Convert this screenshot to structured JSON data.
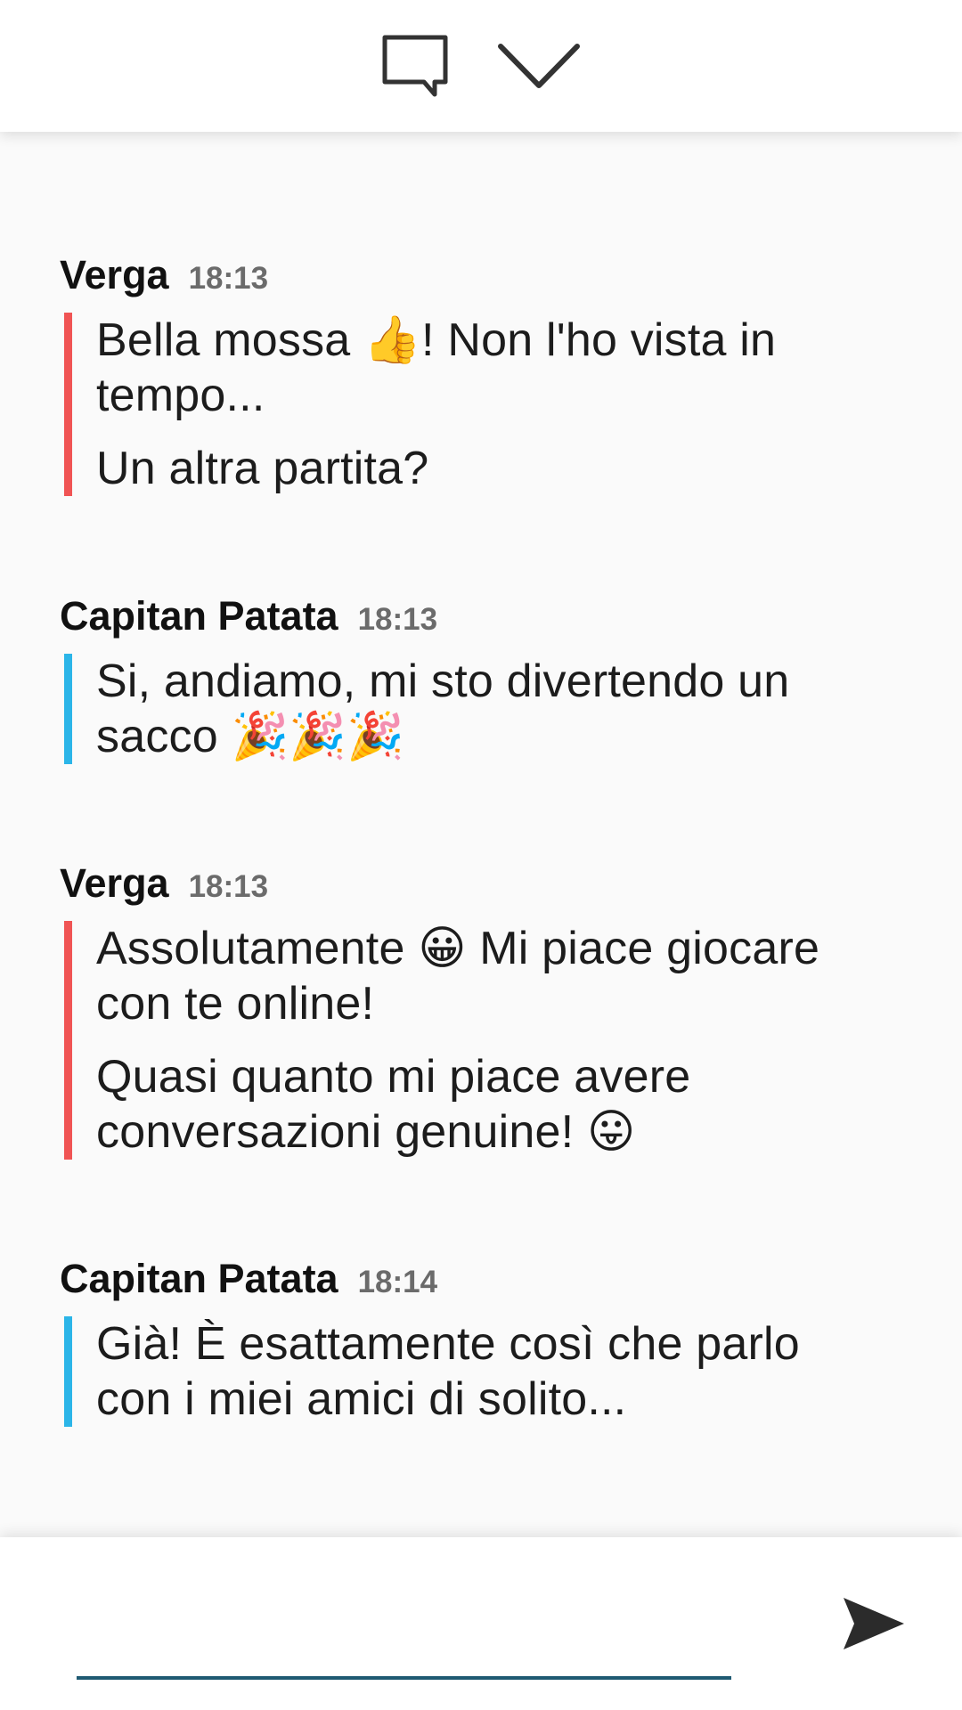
{
  "topbar": {
    "chat_icon": "speech-bubble-icon",
    "collapse_icon": "chevron-down-icon"
  },
  "colors": {
    "player1_accent": "#f05454",
    "player2_accent": "#2bb5e8",
    "input_underline": "#1f5a72"
  },
  "messages": [
    {
      "author": "Verga",
      "time": "18:13",
      "lines": [
        "Bella mossa 👍! Non l'ho vista in tempo...",
        "Un altra partita?"
      ]
    },
    {
      "author": "Capitan Patata",
      "time": "18:13",
      "lines": [
        "Si, andiamo, mi sto divertendo un sacco 🎉🎉🎉"
      ]
    },
    {
      "author": "Verga",
      "time": "18:13",
      "lines": [
        "Assolutamente 😀 Mi piace giocare con te online!",
        "Quasi quanto mi piace avere conversazioni genuine! 😛"
      ]
    },
    {
      "author": "Capitan Patata",
      "time": "18:14",
      "lines": [
        "Già! È esattamente così che parlo con i miei amici di solito..."
      ]
    }
  ],
  "composer": {
    "value": "",
    "send_icon": "send-icon"
  }
}
